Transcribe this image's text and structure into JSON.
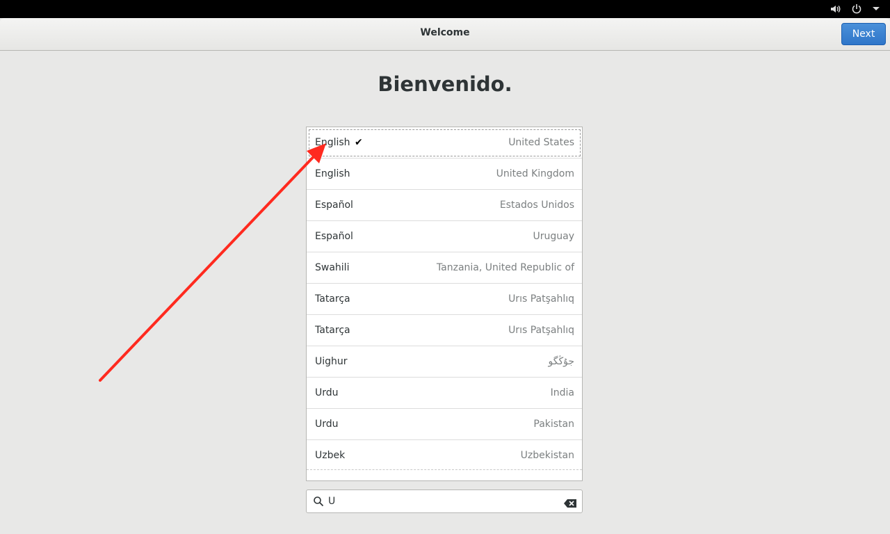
{
  "topbar": {
    "volume_icon": "volume-icon",
    "power_icon": "power-icon",
    "menu_icon": "chevron-down-icon"
  },
  "header": {
    "title": "Welcome",
    "next_label": "Next"
  },
  "heading": "Bienvenido.",
  "languages": [
    {
      "lang": "English",
      "region": "United States",
      "selected": true
    },
    {
      "lang": "English",
      "region": "United Kingdom"
    },
    {
      "lang": "Español",
      "region": "Estados Unidos"
    },
    {
      "lang": "Español",
      "region": "Uruguay"
    },
    {
      "lang": "Swahili",
      "region": "Tanzania, United Republic of"
    },
    {
      "lang": "Tatarça",
      "region": "Urıs Patşahlıq"
    },
    {
      "lang": "Tatarça",
      "region": "Urıs Patşahlıq"
    },
    {
      "lang": "Uighur",
      "region": "جۇڭگو"
    },
    {
      "lang": "Urdu",
      "region": "India"
    },
    {
      "lang": "Urdu",
      "region": "Pakistan"
    },
    {
      "lang": "Uzbek",
      "region": "Uzbekistan"
    }
  ],
  "search": {
    "value": "U",
    "icon": "search-icon",
    "clear_icon": "clear-icon"
  },
  "annotation": {
    "color": "#ff2a1f"
  },
  "colors": {
    "accent": "#3584e4"
  }
}
